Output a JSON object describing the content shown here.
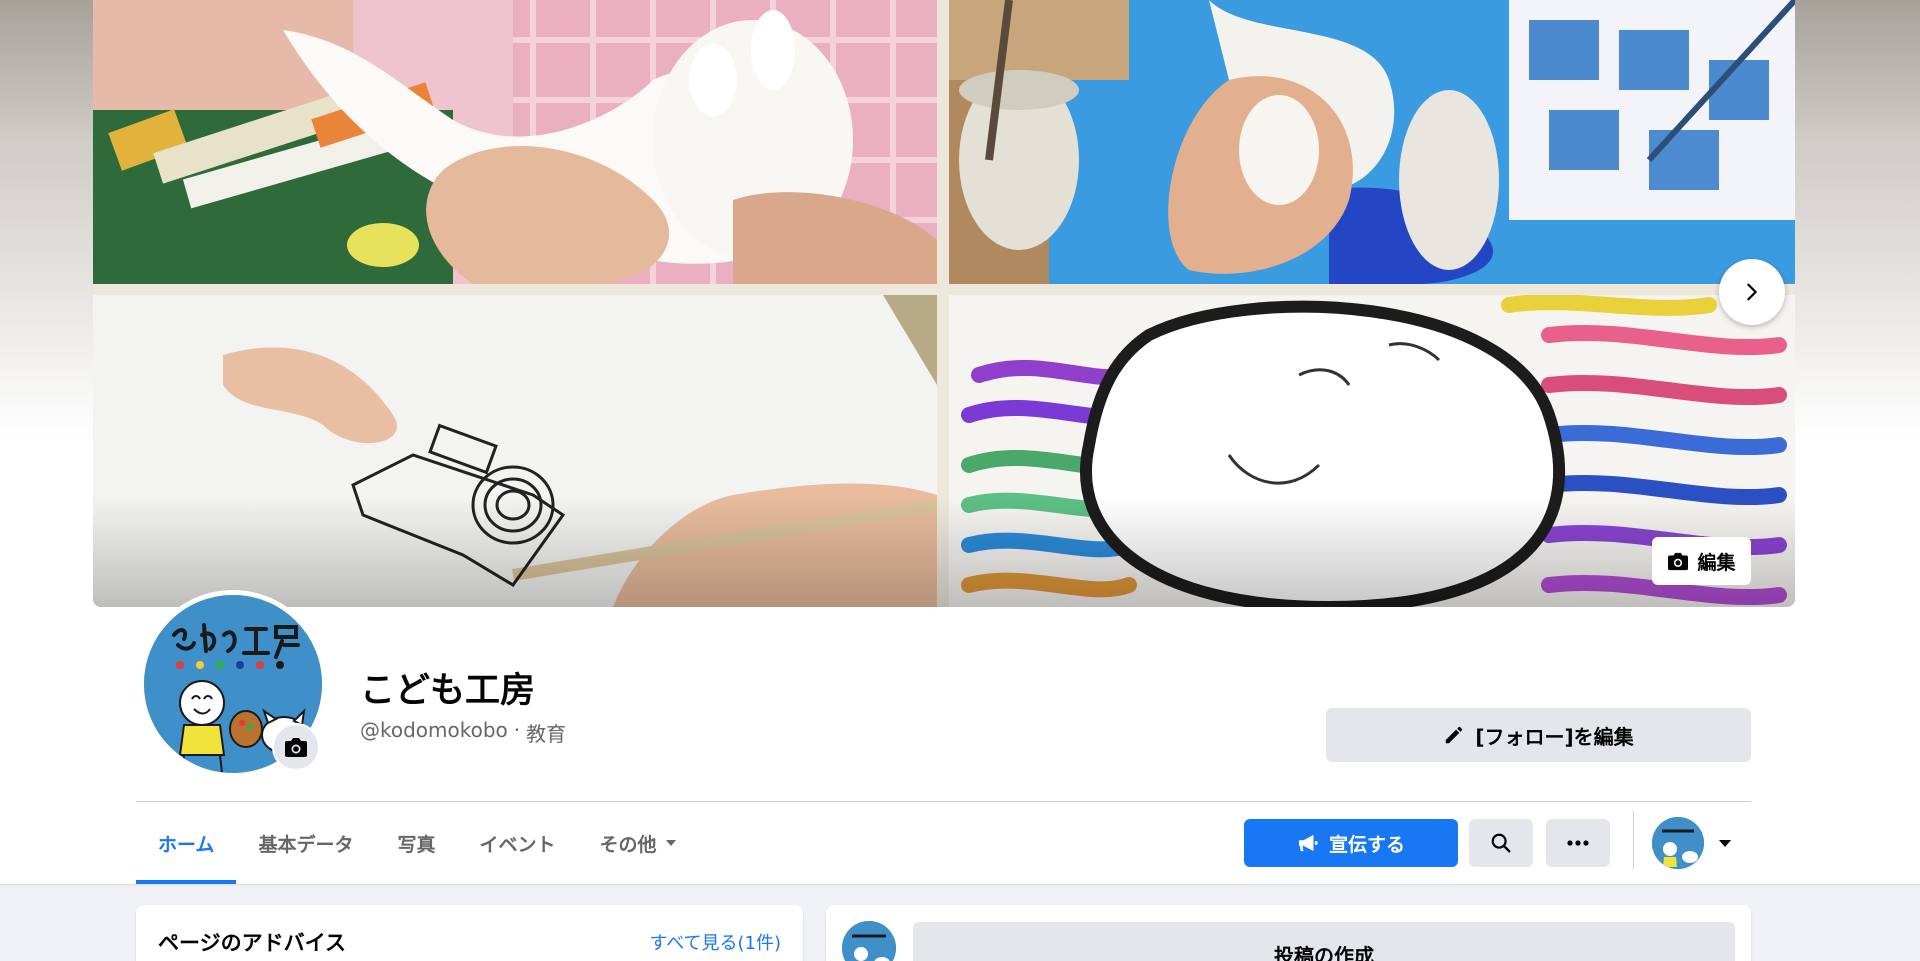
{
  "page": {
    "name": "こども工房",
    "handle": "@kodomokobo",
    "separator": "·",
    "category": "教育"
  },
  "cover": {
    "edit_label": "編集",
    "next_icon": "chevron-right-icon"
  },
  "actions": {
    "follow_edit_label": "[フォロー]を編集",
    "promote_label": "宣伝する",
    "search_icon": "search-icon",
    "more_icon": "more-horizontal-icon"
  },
  "tabs": [
    {
      "label": "ホーム",
      "active": true
    },
    {
      "label": "基本データ",
      "active": false
    },
    {
      "label": "写真",
      "active": false
    },
    {
      "label": "イベント",
      "active": false
    },
    {
      "label": "その他",
      "active": false
    }
  ],
  "advice": {
    "title": "ページのアドバイス",
    "see_all": "すべて見る(1件)"
  },
  "compose": {
    "label": "投稿の作成"
  },
  "colors": {
    "accent": "#1877f2",
    "secondary_button": "#e4e6eb",
    "background": "#f0f2f5",
    "text_secondary": "#65676b"
  }
}
